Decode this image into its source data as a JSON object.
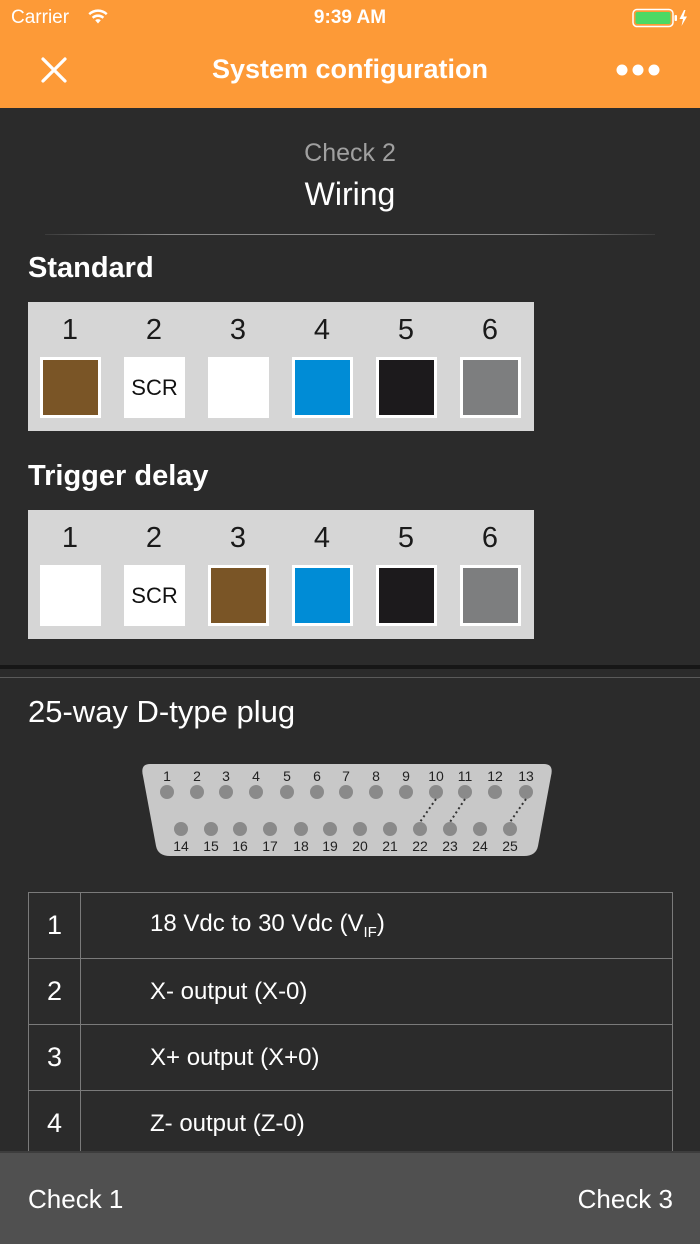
{
  "status_bar": {
    "carrier": "Carrier",
    "time": "9:39 AM",
    "wifi_icon": "wifi-icon",
    "battery_icon": "battery-charging-icon",
    "battery_color": "#4cd964"
  },
  "nav": {
    "title": "System configuration",
    "close_icon": "close-icon",
    "more_icon": "more-horizontal-icon",
    "background": "#fd9a37"
  },
  "check": {
    "subtitle": "Check 2",
    "title": "Wiring"
  },
  "standard": {
    "title": "Standard",
    "wires": [
      {
        "number": "1",
        "color": "#7a5526",
        "label": ""
      },
      {
        "number": "2",
        "color": "#ffffff",
        "label": "SCR"
      },
      {
        "number": "3",
        "color": "#ffffff",
        "label": ""
      },
      {
        "number": "4",
        "color": "#008cd6",
        "label": ""
      },
      {
        "number": "5",
        "color": "#1c1a1c",
        "label": ""
      },
      {
        "number": "6",
        "color": "#7d7e7f",
        "label": ""
      }
    ]
  },
  "trigger_delay": {
    "title": "Trigger delay",
    "wires": [
      {
        "number": "1",
        "color": "#ffffff",
        "label": ""
      },
      {
        "number": "2",
        "color": "#ffffff",
        "label": "SCR"
      },
      {
        "number": "3",
        "color": "#7a5526",
        "label": ""
      },
      {
        "number": "4",
        "color": "#008cd6",
        "label": ""
      },
      {
        "number": "5",
        "color": "#1c1a1c",
        "label": ""
      },
      {
        "number": "6",
        "color": "#7d7e7f",
        "label": ""
      }
    ]
  },
  "plug": {
    "title": "25-way D-type plug",
    "top_pins": [
      "1",
      "2",
      "3",
      "4",
      "5",
      "6",
      "7",
      "8",
      "9",
      "10",
      "11",
      "12",
      "13"
    ],
    "bottom_pins": [
      "14",
      "15",
      "16",
      "17",
      "18",
      "19",
      "20",
      "21",
      "22",
      "23",
      "24",
      "25"
    ],
    "links": [
      [
        "10",
        "22"
      ],
      [
        "11",
        "23"
      ],
      [
        "13",
        "25"
      ]
    ]
  },
  "pin_table": [
    {
      "pin": "1",
      "desc": "18 Vdc to 30 Vdc (V",
      "sub": "IF",
      "tail": ")"
    },
    {
      "pin": "2",
      "desc": "X- output (X-0)",
      "sub": "",
      "tail": ""
    },
    {
      "pin": "3",
      "desc": "X+ output (X+0)",
      "sub": "",
      "tail": ""
    },
    {
      "pin": "4",
      "desc": "Z- output (Z-0)",
      "sub": "",
      "tail": ""
    }
  ],
  "footer": {
    "prev_label": "Check 1",
    "next_label": "Check 3"
  }
}
